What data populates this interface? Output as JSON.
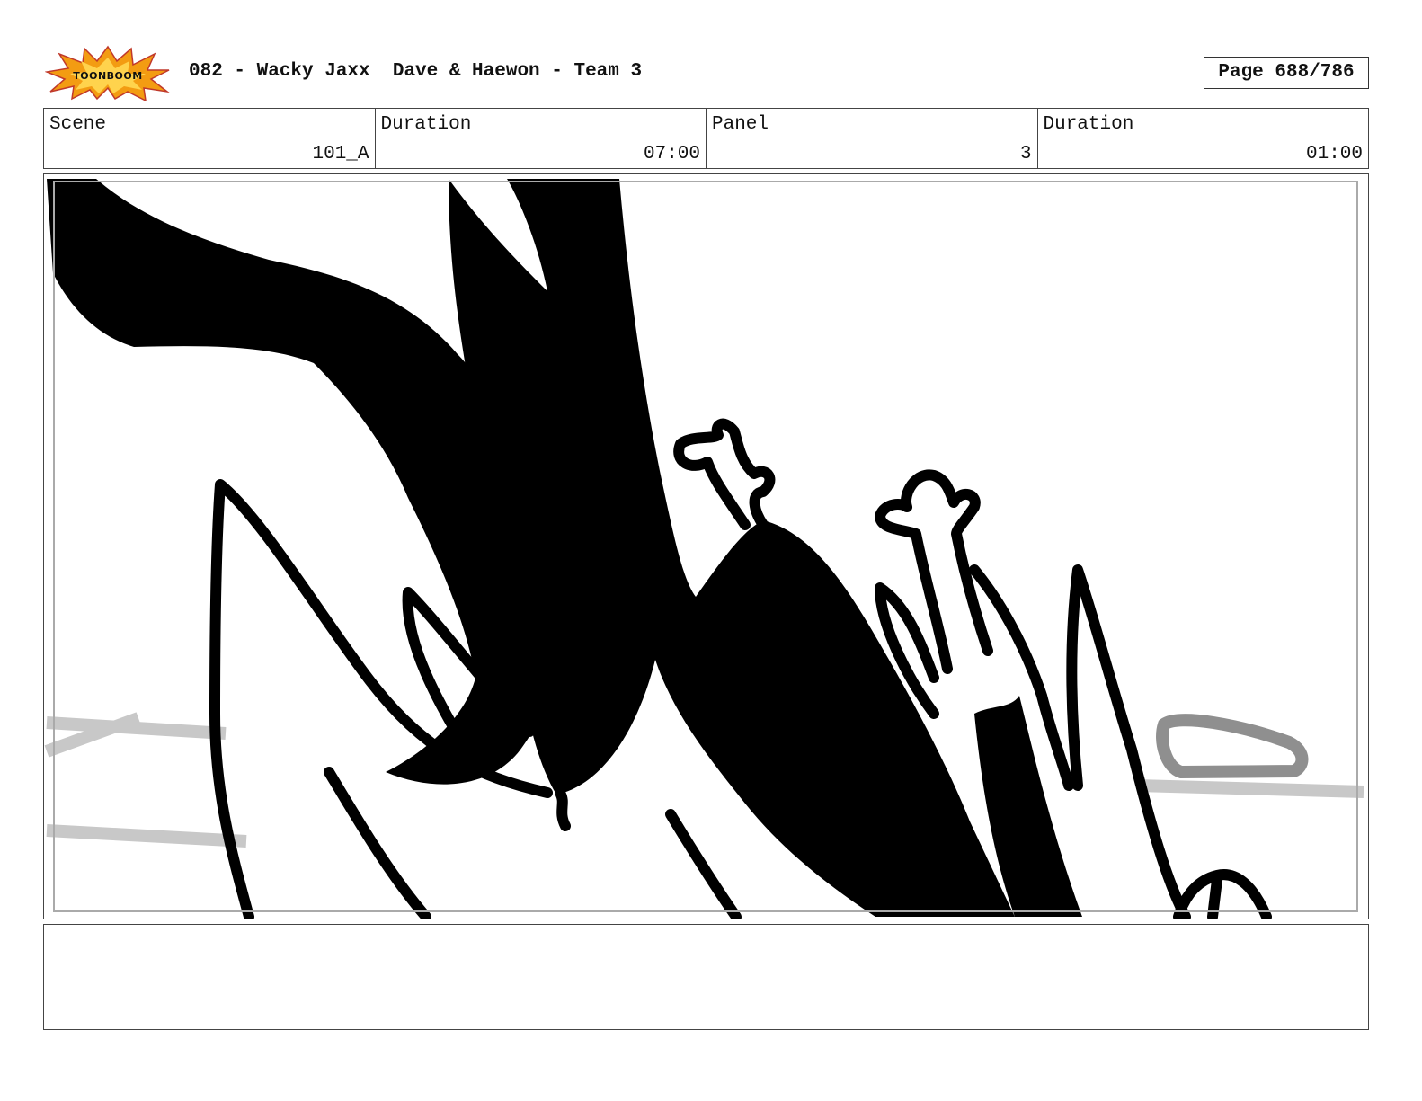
{
  "header": {
    "logo_text": "TOONBOOM",
    "title": "082 - Wacky Jaxx  Dave & Haewon - Team 3",
    "page": "Page 688/786"
  },
  "info": {
    "scene_label": "Scene",
    "scene_value": "101_A",
    "duration_label": "Duration",
    "duration_value": "07:00",
    "panel_label": "Panel",
    "panel_value": "3",
    "panel_duration_label": "Duration",
    "panel_duration_value": "01:00"
  },
  "colors": {
    "logo_burst": "#f39c12",
    "ink": "#000000",
    "guide_gray": "#c8c8c8",
    "prop_gray": "#8f8f8f"
  }
}
